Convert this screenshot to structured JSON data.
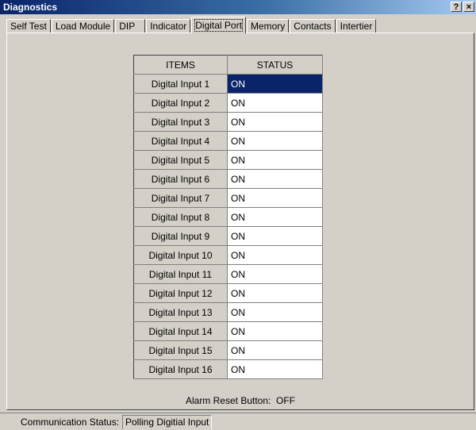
{
  "window": {
    "title": "Diagnostics",
    "help_button": "?",
    "close_button": "×"
  },
  "tabs": [
    {
      "label": "Self Test"
    },
    {
      "label": "Load Module"
    },
    {
      "label": "DIP"
    },
    {
      "label": "Indicator"
    },
    {
      "label": "Digital Port",
      "active": true
    },
    {
      "label": "Memory"
    },
    {
      "label": "Contacts"
    },
    {
      "label": "Intertier"
    }
  ],
  "grid": {
    "headers": {
      "items": "ITEMS",
      "status": "STATUS"
    },
    "rows": [
      {
        "item": "Digital Input 1",
        "status": "ON",
        "selected": true
      },
      {
        "item": "Digital Input 2",
        "status": "ON"
      },
      {
        "item": "Digital Input 3",
        "status": "ON"
      },
      {
        "item": "Digital Input 4",
        "status": "ON"
      },
      {
        "item": "Digital Input 5",
        "status": "ON"
      },
      {
        "item": "Digital Input 6",
        "status": "ON"
      },
      {
        "item": "Digital Input 7",
        "status": "ON"
      },
      {
        "item": "Digital Input 8",
        "status": "ON"
      },
      {
        "item": "Digital Input 9",
        "status": "ON"
      },
      {
        "item": "Digital Input 10",
        "status": "ON"
      },
      {
        "item": "Digital Input 11",
        "status": "ON"
      },
      {
        "item": "Digital Input 12",
        "status": "ON"
      },
      {
        "item": "Digital Input 13",
        "status": "ON"
      },
      {
        "item": "Digital Input 14",
        "status": "ON"
      },
      {
        "item": "Digital Input 15",
        "status": "ON"
      },
      {
        "item": "Digital Input 16",
        "status": "ON"
      }
    ]
  },
  "alarm": {
    "label": "Alarm Reset Button:",
    "value": "OFF"
  },
  "status_bar": {
    "label": "Communication Status:",
    "value": "Polling Digitial Input"
  }
}
